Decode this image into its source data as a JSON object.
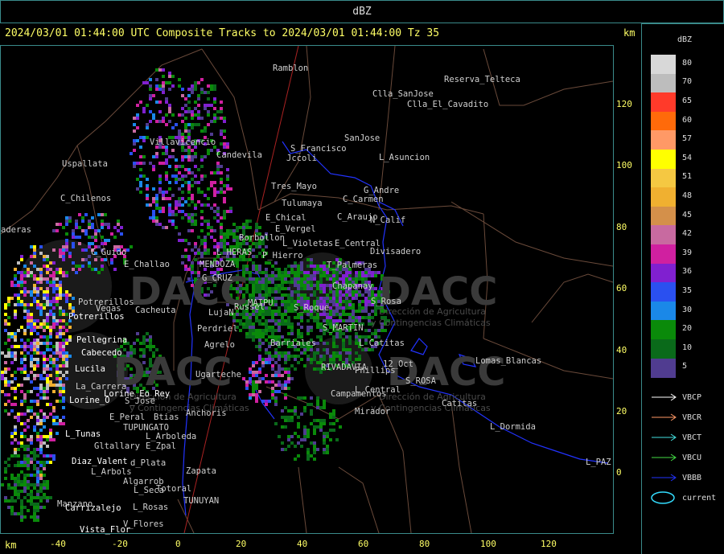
{
  "window": {
    "title": "dBZ"
  },
  "header": {
    "title": "2024/03/01 01:44:00 UTC Composite Tracks to 2024/03/01 01:44:00 Tz 35",
    "km_unit_top": "km",
    "km_unit_bottom": "km"
  },
  "axes": {
    "y_ticks": [
      "120",
      "100",
      "80",
      "60",
      "40",
      "20",
      "0"
    ],
    "x_ticks": [
      "-40",
      "-20",
      "0",
      "20",
      "40",
      "60",
      "80",
      "100",
      "120"
    ]
  },
  "legend": {
    "title": "dBZ",
    "scale": [
      {
        "value": "80",
        "color": "#d8d8d8"
      },
      {
        "value": "70",
        "color": "#bdbdbd"
      },
      {
        "value": "65",
        "color": "#ff3a2a"
      },
      {
        "value": "60",
        "color": "#ff6a0a"
      },
      {
        "value": "57",
        "color": "#ff9966"
      },
      {
        "value": "54",
        "color": "#ffff00"
      },
      {
        "value": "51",
        "color": "#f5c842"
      },
      {
        "value": "48",
        "color": "#f0b030"
      },
      {
        "value": "45",
        "color": "#d4904a"
      },
      {
        "value": "42",
        "color": "#c86aa0"
      },
      {
        "value": "39",
        "color": "#d020a0"
      },
      {
        "value": "36",
        "color": "#8020d0"
      },
      {
        "value": "35",
        "color": "#2a50f0"
      },
      {
        "value": "30",
        "color": "#1a88e8"
      },
      {
        "value": "20",
        "color": "#0a8a0a"
      },
      {
        "value": "10",
        "color": "#0a6a1a"
      },
      {
        "value": "5",
        "color": "#503c90"
      }
    ],
    "tracks": [
      {
        "label": "VBCP",
        "color": "#ffffff"
      },
      {
        "label": "VBCR",
        "color": "#ff9966"
      },
      {
        "label": "VBCT",
        "color": "#44e0e0"
      },
      {
        "label": "VBCU",
        "color": "#44dd44"
      },
      {
        "label": "VBBB",
        "color": "#2233ff"
      },
      {
        "label": "current",
        "color": "#33ddff"
      }
    ]
  },
  "watermark": {
    "brand": "DACC",
    "tagline_1": "Dirección de Agricultura",
    "tagline_2": "y Contingencias Climáticas"
  },
  "places": [
    {
      "name": "Ramblon",
      "color": "#cfcfcf"
    },
    {
      "name": "Reserva_Telteca",
      "color": "#cfcfcf"
    },
    {
      "name": "Clla_SanJose",
      "color": "#cfcfcf"
    },
    {
      "name": "Clla_El_Cavadito",
      "color": "#cfcfcf"
    },
    {
      "name": "Villavicencio",
      "color": "#cfcfcf"
    },
    {
      "name": "Candevila",
      "color": "#cfcfcf"
    },
    {
      "name": "S_Francisco",
      "color": "#cfcfcf"
    },
    {
      "name": "Jccoli",
      "color": "#cfcfcf"
    },
    {
      "name": "SanJose",
      "color": "#cfcfcf"
    },
    {
      "name": "L_Asuncion",
      "color": "#cfcfcf"
    },
    {
      "name": "Uspallata",
      "color": "#cfcfcf"
    },
    {
      "name": "Tres_Mayo",
      "color": "#cfcfcf"
    },
    {
      "name": "G_Andre",
      "color": "#cfcfcf"
    },
    {
      "name": "C_Carmen",
      "color": "#cfcfcf"
    },
    {
      "name": "C_Chilenos",
      "color": "#cfcfcf"
    },
    {
      "name": "Tulumaya",
      "color": "#cfcfcf"
    },
    {
      "name": "E_Chical",
      "color": "#cfcfcf"
    },
    {
      "name": "C_Araujo",
      "color": "#cfcfcf"
    },
    {
      "name": "N_Calif",
      "color": "#cfcfcf"
    },
    {
      "name": "E_Vergel",
      "color": "#cfcfcf"
    },
    {
      "name": "Borbollon",
      "color": "#cfcfcf"
    },
    {
      "name": "L_Violetas",
      "color": "#cfcfcf"
    },
    {
      "name": "E_Central",
      "color": "#cfcfcf"
    },
    {
      "name": "Divisadero",
      "color": "#cfcfcf"
    },
    {
      "name": "aderas",
      "color": "#cfcfcf"
    },
    {
      "name": "C_Guido",
      "color": "#cfcfcf"
    },
    {
      "name": "L_HERAS",
      "color": "#cfcfcf"
    },
    {
      "name": "P_Hierro",
      "color": "#cfcfcf"
    },
    {
      "name": "E_Challao",
      "color": "#cfcfcf"
    },
    {
      "name": "MENDOZA",
      "color": "#cfcfcf"
    },
    {
      "name": "T_Palmeras",
      "color": "#cfcfcf"
    },
    {
      "name": "G_CRUZ",
      "color": "#cfcfcf"
    },
    {
      "name": "Chapanay",
      "color": "#cfcfcf"
    },
    {
      "name": "S_Rosa",
      "color": "#cfcfcf"
    },
    {
      "name": "Potrerillos",
      "color": "#cfcfcf"
    },
    {
      "name": "Vegas",
      "color": "#cfcfcf"
    },
    {
      "name": "Cacheuta",
      "color": "#cfcfcf"
    },
    {
      "name": "Russel",
      "color": "#cfcfcf"
    },
    {
      "name": "LujaN",
      "color": "#cfcfcf"
    },
    {
      "name": "S_Roque",
      "color": "#cfcfcf"
    },
    {
      "name": "Potrerillos",
      "color": "#ffffff"
    },
    {
      "name": "Perdriel",
      "color": "#cfcfcf"
    },
    {
      "name": "MAIPU",
      "color": "#cfcfcf"
    },
    {
      "name": "Pellegrina",
      "color": "#ffffff"
    },
    {
      "name": "Cabecedo",
      "color": "#ffffff"
    },
    {
      "name": "S_MARTIN",
      "color": "#cfcfcf"
    },
    {
      "name": "Agrelo",
      "color": "#cfcfcf"
    },
    {
      "name": "Barriales",
      "color": "#cfcfcf"
    },
    {
      "name": "L_Catitas",
      "color": "#cfcfcf"
    },
    {
      "name": "Lucila",
      "color": "#ffffff"
    },
    {
      "name": "Lomas_Blancas",
      "color": "#cfcfcf"
    },
    {
      "name": "RIVADAVIA",
      "color": "#cfcfcf"
    },
    {
      "name": "12_Oct",
      "color": "#cfcfcf"
    },
    {
      "name": "Phillips",
      "color": "#cfcfcf"
    },
    {
      "name": "Ugarteche",
      "color": "#cfcfcf"
    },
    {
      "name": "S_ROSA",
      "color": "#cfcfcf"
    },
    {
      "name": "La_Carrera",
      "color": "#cfcfcf"
    },
    {
      "name": "Lorine_Eo_Rey",
      "color": "#ffffff"
    },
    {
      "name": "Campamentos",
      "color": "#cfcfcf"
    },
    {
      "name": "Lorine_O",
      "color": "#ffffff"
    },
    {
      "name": "L_Central",
      "color": "#cfcfcf"
    },
    {
      "name": "Catitas",
      "color": "#cfcfcf"
    },
    {
      "name": "S_Jose",
      "color": "#cfcfcf"
    },
    {
      "name": "Anchoris",
      "color": "#cfcfcf"
    },
    {
      "name": "Mirador",
      "color": "#cfcfcf"
    },
    {
      "name": "E_Peral",
      "color": "#cfcfcf"
    },
    {
      "name": "Btias",
      "color": "#cfcfcf"
    },
    {
      "name": "TUPUNGATO",
      "color": "#cfcfcf"
    },
    {
      "name": "L_Dormida",
      "color": "#cfcfcf"
    },
    {
      "name": "L_Tunas",
      "color": "#ffffff"
    },
    {
      "name": "L_Arboleda",
      "color": "#cfcfcf"
    },
    {
      "name": "Gltallary",
      "color": "#cfcfcf"
    },
    {
      "name": "E_Zpal",
      "color": "#cfcfcf"
    },
    {
      "name": "Diaz_Valent",
      "color": "#ffffff"
    },
    {
      "name": "d_Plata",
      "color": "#cfcfcf"
    },
    {
      "name": "L_PAZ",
      "color": "#cfcfcf"
    },
    {
      "name": "L_Arbols",
      "color": "#cfcfcf"
    },
    {
      "name": "Zapata",
      "color": "#cfcfcf"
    },
    {
      "name": "Algarrob",
      "color": "#cfcfcf"
    },
    {
      "name": "L_Seca",
      "color": "#cfcfcf"
    },
    {
      "name": "Totoral",
      "color": "#cfcfcf"
    },
    {
      "name": "Manzano",
      "color": "#cfcfcf"
    },
    {
      "name": "TUNUYAN",
      "color": "#cfcfcf"
    },
    {
      "name": "Carrizalejo",
      "color": "#ffffff"
    },
    {
      "name": "L_Rosas",
      "color": "#cfcfcf"
    },
    {
      "name": "V_Flores",
      "color": "#cfcfcf"
    },
    {
      "name": "Vista_Flor",
      "color": "#ffffff"
    }
  ]
}
